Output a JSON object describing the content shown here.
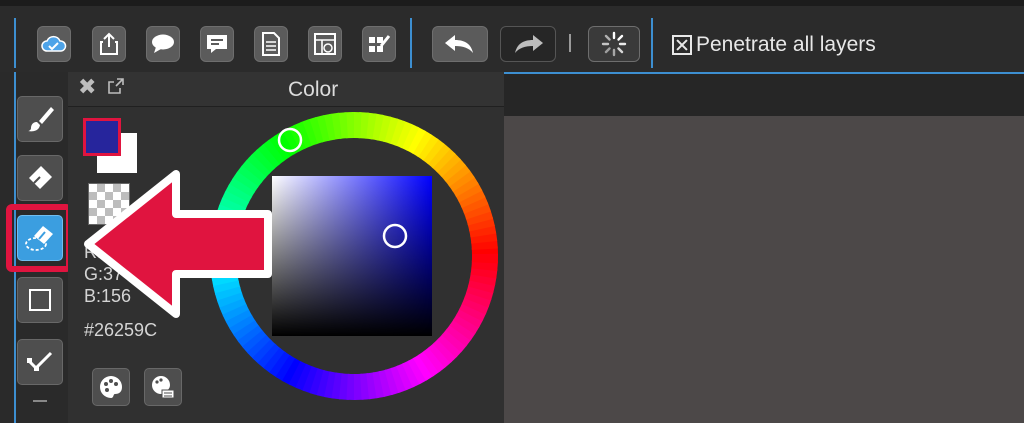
{
  "toolbar": {
    "buttons": [
      {
        "name": "cloud-sync",
        "icon": "cloud-check-icon"
      },
      {
        "name": "share",
        "icon": "share-icon"
      },
      {
        "name": "speech-bubble",
        "icon": "speech-bubble-icon"
      },
      {
        "name": "comment",
        "icon": "comment-icon"
      },
      {
        "name": "document",
        "icon": "document-icon"
      },
      {
        "name": "timeline",
        "icon": "timeline-icon"
      },
      {
        "name": "edit-list",
        "icon": "edit-list-icon"
      },
      {
        "name": "undo",
        "icon": "undo-icon"
      },
      {
        "name": "redo",
        "icon": "redo-icon"
      },
      {
        "name": "loading",
        "icon": "spinner-icon"
      }
    ],
    "penetrate_label": "Penetrate all layers"
  },
  "tools": [
    {
      "name": "brush",
      "icon": "brush-icon",
      "active": false
    },
    {
      "name": "eraser",
      "icon": "eraser-icon",
      "active": false
    },
    {
      "name": "selection-eraser",
      "icon": "selection-eraser-icon",
      "active": true
    },
    {
      "name": "rectangle",
      "icon": "rectangle-icon",
      "active": false
    },
    {
      "name": "vector",
      "icon": "vector-icon",
      "active": false
    }
  ],
  "color_panel": {
    "title": "Color",
    "rgb": {
      "r": "R:38",
      "g": "G:37",
      "b": "B:156"
    },
    "hex": "#26259C",
    "foreground_color": "#26259c",
    "background_color": "#ffffff"
  },
  "annotation": {
    "color": "#e0143f",
    "icon": "arrow-left-icon"
  }
}
